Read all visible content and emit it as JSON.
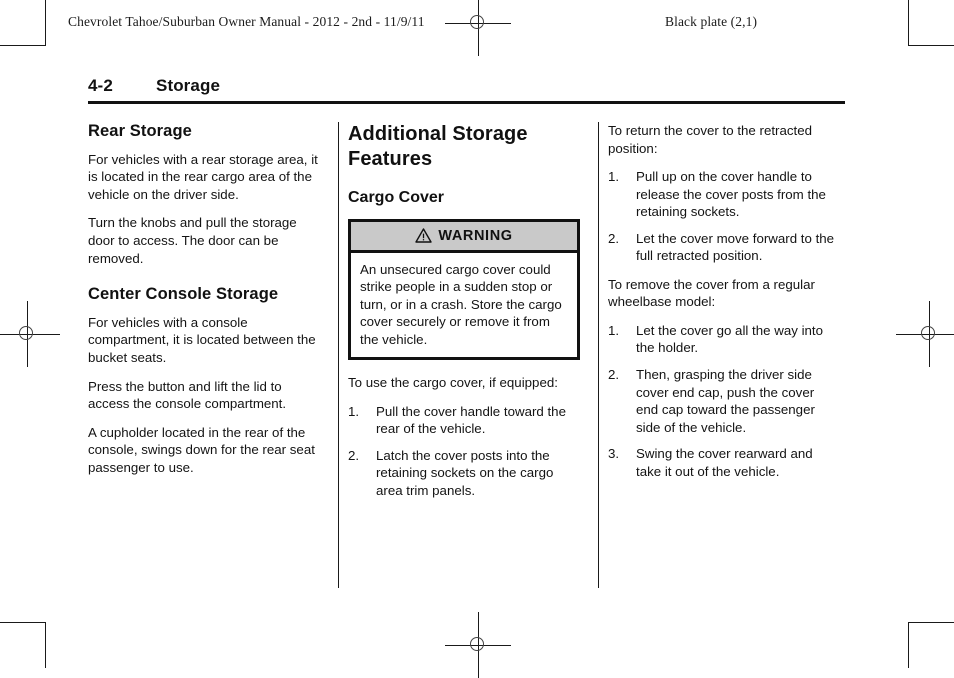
{
  "running_heads": {
    "left": "Chevrolet Tahoe/Suburban Owner Manual - 2012 - 2nd - 11/9/11",
    "right": "Black plate (2,1)"
  },
  "page_header": {
    "folio": "4-2",
    "section_title": "Storage"
  },
  "columns": {
    "left": {
      "heading_1": "Rear Storage",
      "para_1": "For vehicles with a rear storage area, it is located in the rear cargo area of the vehicle on the driver side.",
      "para_2": "Turn the knobs and pull the storage door to access. The door can be removed.",
      "heading_2": "Center Console Storage",
      "para_3": "For vehicles with a console compartment, it is located between the bucket seats.",
      "para_4": "Press the button and lift the lid to access the console compartment.",
      "para_5": "A cupholder located in the rear of the console, swings down for the rear seat passenger to use."
    },
    "middle": {
      "heading_main": "Additional Storage Features",
      "heading_sub": "Cargo Cover",
      "warning": {
        "label": "WARNING",
        "icon": "warning-triangle-icon",
        "text": "An unsecured cargo cover could strike people in a sudden stop or turn, or in a crash. Store the cargo cover securely or remove it from the vehicle."
      },
      "intro": "To use the cargo cover, if equipped:",
      "steps": [
        {
          "num": "1.",
          "text": "Pull the cover handle toward the rear of the vehicle."
        },
        {
          "num": "2.",
          "text": "Latch the cover posts into the retaining sockets on the cargo area trim panels."
        }
      ]
    },
    "right": {
      "intro_1": "To return the cover to the retracted position:",
      "steps_1": [
        {
          "num": "1.",
          "text": "Pull up on the cover handle to release the cover posts from the retaining sockets."
        },
        {
          "num": "2.",
          "text": "Let the cover move forward to the full retracted position."
        }
      ],
      "intro_2": "To remove the cover from a regular wheelbase model:",
      "steps_2": [
        {
          "num": "1.",
          "text": "Let the cover go all the way into the holder."
        },
        {
          "num": "2.",
          "text": "Then, grasping the driver side cover end cap, push the cover end cap toward the passenger side of the vehicle."
        },
        {
          "num": "3.",
          "text": "Swing the cover rearward and take it out of the vehicle."
        }
      ]
    }
  },
  "print_marks": {
    "warning_header_bg": "#c9c9c9",
    "rule_color": "#111111"
  }
}
